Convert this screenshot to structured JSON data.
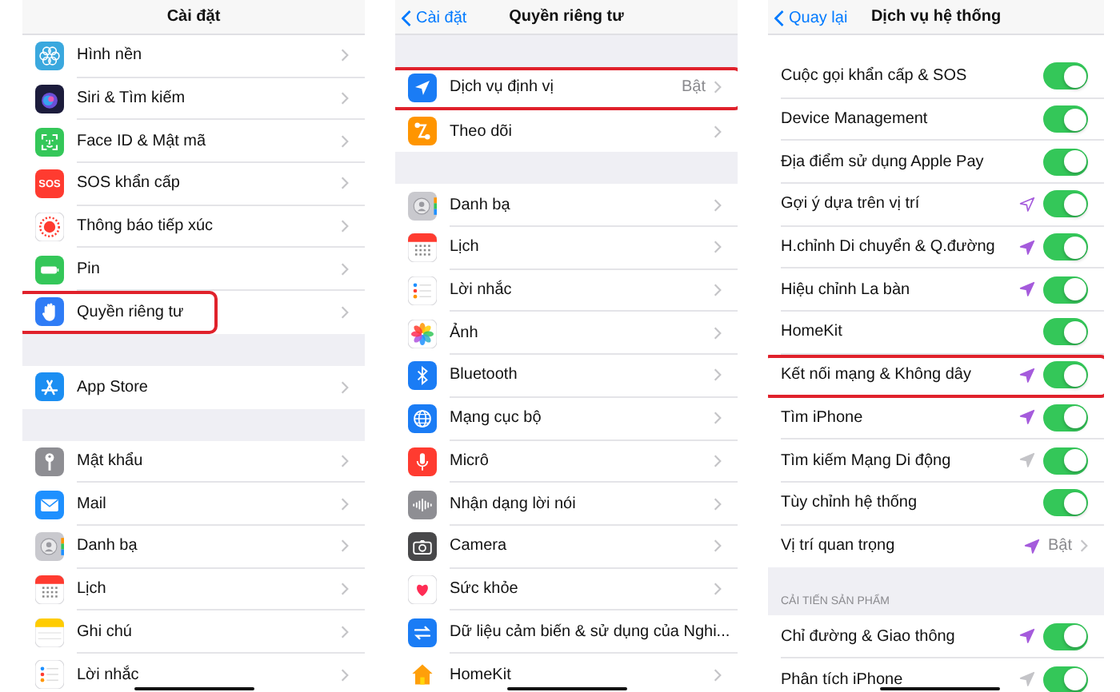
{
  "panels": [
    {
      "title": "Cài đặt",
      "groups": [
        {
          "items": [
            {
              "label": "Hình nền"
            },
            {
              "label": "Siri & Tìm kiếm"
            },
            {
              "label": "Face ID & Mật mã"
            },
            {
              "label": "SOS khẩn cấp",
              "icon_text": "SOS"
            },
            {
              "label": "Thông báo tiếp xúc"
            },
            {
              "label": "Pin"
            },
            {
              "label": "Quyền riêng tư",
              "highlighted": true
            }
          ]
        },
        {
          "items": [
            {
              "label": "App Store"
            }
          ]
        },
        {
          "items": [
            {
              "label": "Mật khẩu"
            },
            {
              "label": "Mail"
            },
            {
              "label": "Danh bạ"
            },
            {
              "label": "Lịch"
            },
            {
              "label": "Ghi chú"
            },
            {
              "label": "Lời nhắc"
            }
          ]
        }
      ]
    },
    {
      "title": "Quyền riêng tư",
      "back": "Cài đặt",
      "groups": [
        {
          "items": [
            {
              "label": "Dịch vụ định vị",
              "value": "Bật",
              "highlighted": true
            },
            {
              "label": "Theo dõi"
            }
          ]
        },
        {
          "items": [
            {
              "label": "Danh bạ"
            },
            {
              "label": "Lịch"
            },
            {
              "label": "Lời nhắc"
            },
            {
              "label": "Ảnh"
            },
            {
              "label": "Bluetooth"
            },
            {
              "label": "Mạng cục bộ"
            },
            {
              "label": "Micrô"
            },
            {
              "label": "Nhận dạng lời nói"
            },
            {
              "label": "Camera"
            },
            {
              "label": "Sức khỏe"
            },
            {
              "label": "Dữ liệu cảm biến & sử dụng của Nghi..."
            },
            {
              "label": "HomeKit"
            }
          ]
        }
      ]
    },
    {
      "title": "Dịch vụ hệ thống",
      "back": "Quay lại",
      "groups": [
        {
          "items": [
            {
              "label": "Cuộc gọi khẩn cấp & SOS",
              "on": true
            },
            {
              "label": "Device Management",
              "on": true
            },
            {
              "label": "Địa điểm sử dụng Apple Pay",
              "on": true
            },
            {
              "label": "Gợi ý dựa trên vị trí",
              "color": "#a55bdc",
              "location_filled": false,
              "on": true
            },
            {
              "label": "H.chỉnh Di chuyển & Q.đường",
              "color": "#a55bdc",
              "location_filled": true,
              "on": true
            },
            {
              "label": "Hiệu chỉnh La bàn",
              "color": "#a55bdc",
              "location_filled": true,
              "on": true
            },
            {
              "label": "HomeKit",
              "on": true
            },
            {
              "label": "Kết nối mạng & Không dây",
              "color": "#a55bdc",
              "location_filled": true,
              "on": true,
              "highlighted": true
            },
            {
              "label": "Tìm iPhone",
              "color": "#a55bdc",
              "location_filled": true,
              "on": true
            },
            {
              "label": "Tìm kiếm Mạng Di động",
              "color": "#c4c4c8",
              "location_filled": true,
              "on": true
            },
            {
              "label": "Tùy chỉnh hệ thống",
              "on": true
            },
            {
              "label": "Vị trí quan trọng",
              "color": "#a55bdc",
              "location_filled": true,
              "value": "Bật"
            }
          ]
        },
        {
          "header": "CẢI TIẾN SẢN PHẨM",
          "items": [
            {
              "label": "Chỉ đường & Giao thông",
              "color": "#a55bdc",
              "location_filled": true,
              "on": true
            },
            {
              "label": "Phân tích iPhone",
              "color": "#c4c4c8",
              "location_filled": true,
              "on": true
            }
          ]
        }
      ]
    }
  ]
}
